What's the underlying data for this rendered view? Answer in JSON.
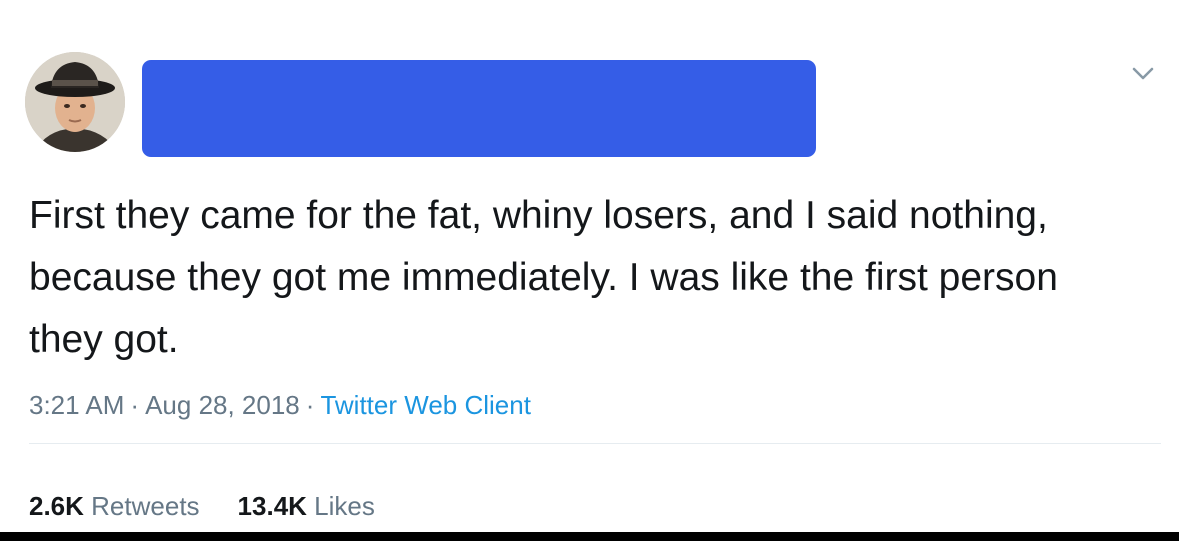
{
  "tweet": {
    "text": "First they came for the fat, whiny losers, and I said nothing, because they got me immediately. I was like the first person they got.",
    "time": "3:21 AM",
    "date": "Aug 28, 2018",
    "separator": "·",
    "client": "Twitter Web Client"
  },
  "stats": {
    "retweets_count": "2.6K",
    "retweets_label": "Retweets",
    "likes_count": "13.4K",
    "likes_label": "Likes"
  },
  "icons": {
    "menu": "chevron-down-icon",
    "avatar": "avatar"
  },
  "colors": {
    "redaction": "#355de7",
    "meta": "#657786",
    "link": "#1b95e0",
    "text": "#14171a"
  }
}
